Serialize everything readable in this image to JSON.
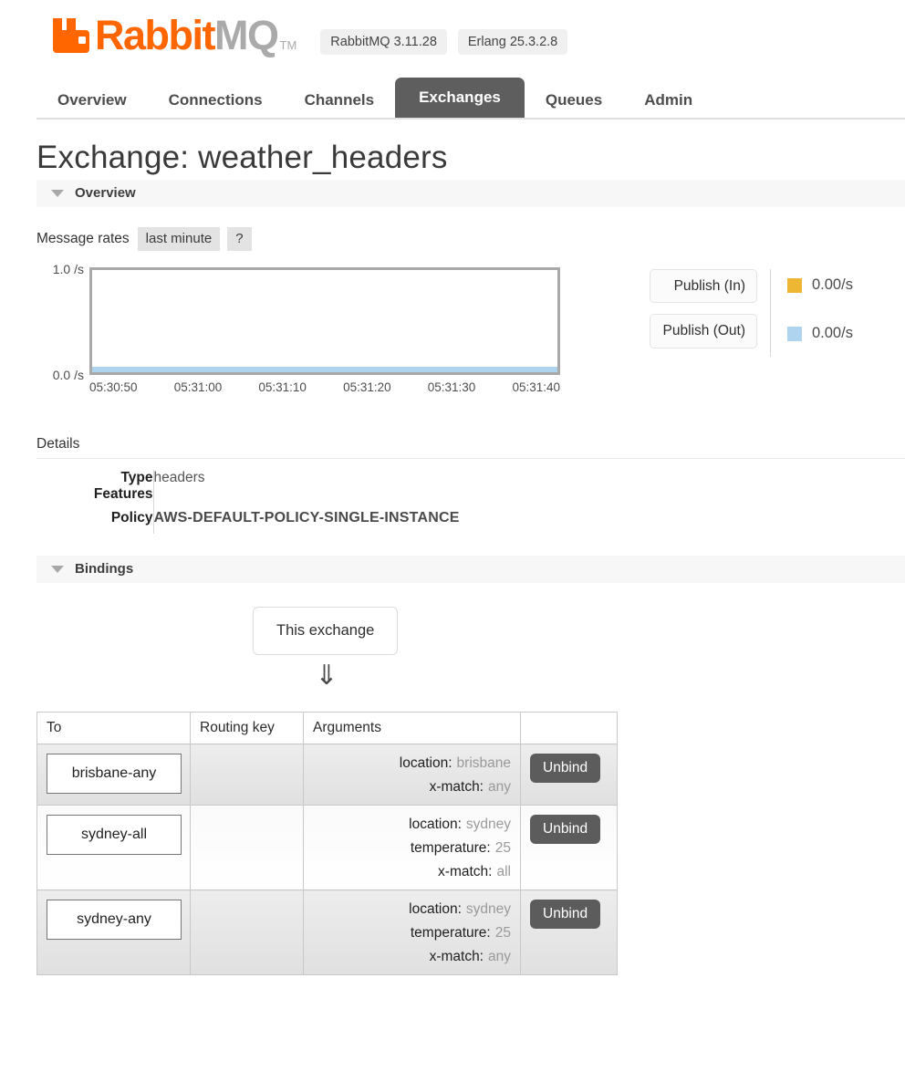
{
  "brand": {
    "name_rabbit": "Rabbit",
    "name_mq": "MQ",
    "tm": "TM",
    "versions": [
      "RabbitMQ 3.11.28",
      "Erlang 25.3.2.8"
    ]
  },
  "nav": {
    "tabs": [
      {
        "label": "Overview",
        "active": false
      },
      {
        "label": "Connections",
        "active": false
      },
      {
        "label": "Channels",
        "active": false
      },
      {
        "label": "Exchanges",
        "active": true
      },
      {
        "label": "Queues",
        "active": false
      },
      {
        "label": "Admin",
        "active": false
      }
    ]
  },
  "page": {
    "title": "Exchange: weather_headers"
  },
  "overview": {
    "section_label": "Overview",
    "rates_label": "Message rates",
    "period_chip": "last minute",
    "help_chip": "?"
  },
  "chart_data": {
    "type": "line",
    "title": "Message rates",
    "xlabel": "",
    "ylabel": "/s",
    "ylim": [
      0.0,
      1.0
    ],
    "ytick_labels": [
      "1.0 /s",
      "0.0 /s"
    ],
    "x": [
      "05:30:50",
      "05:31:00",
      "05:31:10",
      "05:31:20",
      "05:31:30",
      "05:31:40"
    ],
    "grid": false,
    "legend_position": "right",
    "series": [
      {
        "name": "Publish (In)",
        "color": "#edb733",
        "current": "0.00/s",
        "values": [
          0,
          0,
          0,
          0,
          0,
          0
        ]
      },
      {
        "name": "Publish (Out)",
        "color": "#aed4f0",
        "current": "0.00/s",
        "values": [
          0,
          0,
          0,
          0,
          0,
          0
        ]
      }
    ]
  },
  "details": {
    "heading": "Details",
    "rows": [
      {
        "label": "Type",
        "value": "headers",
        "style": "plain"
      },
      {
        "label": "Features",
        "value": "",
        "style": "plain"
      },
      {
        "label": "Policy",
        "value": "AWS-DEFAULT-POLICY-SINGLE-INSTANCE",
        "style": "policy"
      }
    ]
  },
  "bindings": {
    "section_label": "Bindings",
    "source_box": "This exchange",
    "arrow": "⇓",
    "columns": [
      "To",
      "Routing key",
      "Arguments",
      ""
    ],
    "rows": [
      {
        "to": "brisbane-any",
        "routing_key": "",
        "arguments": [
          {
            "key": "location:",
            "value": "brisbane"
          },
          {
            "key": "x-match:",
            "value": "any"
          }
        ],
        "action": "Unbind"
      },
      {
        "to": "sydney-all",
        "routing_key": "",
        "arguments": [
          {
            "key": "location:",
            "value": "sydney"
          },
          {
            "key": "temperature:",
            "value": "25"
          },
          {
            "key": "x-match:",
            "value": "all"
          }
        ],
        "action": "Unbind"
      },
      {
        "to": "sydney-any",
        "routing_key": "",
        "arguments": [
          {
            "key": "location:",
            "value": "sydney"
          },
          {
            "key": "temperature:",
            "value": "25"
          },
          {
            "key": "x-match:",
            "value": "any"
          }
        ],
        "action": "Unbind"
      }
    ]
  },
  "colors": {
    "brand_orange": "#ff6600",
    "active_tab": "#5e5e5e",
    "publish_in": "#edb733",
    "publish_out": "#aed4f0"
  }
}
